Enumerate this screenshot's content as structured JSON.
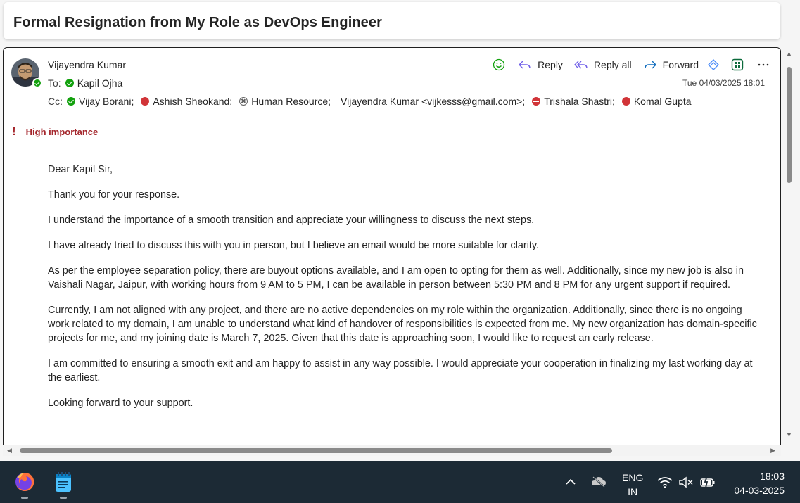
{
  "subject": "Formal Resignation from My Role as DevOps Engineer",
  "message": {
    "sender": "Vijayendra Kumar",
    "to_label": "To:",
    "to": [
      {
        "name": "Kapil Ojha",
        "status": "available"
      }
    ],
    "cc_label": "Cc:",
    "cc": [
      {
        "name": "Vijay Borani;",
        "status": "available"
      },
      {
        "name": "Ashish Sheokand;",
        "status": "busy"
      },
      {
        "name": "Human Resource;",
        "status": "offline"
      },
      {
        "name": "Vijayendra Kumar <vijkesss@gmail.com>;",
        "status": "none"
      },
      {
        "name": "Trishala Shastri;",
        "status": "do-not-disturb"
      },
      {
        "name": "Komal Gupta",
        "status": "busy"
      }
    ],
    "timestamp": "Tue 04/03/2025 18:01",
    "importance": "High importance",
    "actions": {
      "reply": "Reply",
      "reply_all": "Reply all",
      "forward": "Forward"
    },
    "body": [
      "Dear Kapil Sir,",
      "Thank you for your response.",
      "I understand the importance of a smooth transition and appreciate your willingness to discuss the next steps.",
      "I have already tried to discuss this with you in person, but I believe an email would be more suitable for clarity.",
      "As per the employee separation policy, there are buyout options available, and I am open to opting for them as well. Additionally, since my new job is also in Vaishali Nagar, Jaipur, with working hours from 9 AM to 5 PM, I can be available in person between 5:30 PM and 8 PM for any urgent support if required.",
      "Currently, I am not aligned with any project, and there are no active dependencies on my role within the organization. Additionally, since there is no ongoing work related to my domain, I am unable to understand what kind of handover of responsibilities is expected from me. My new organization has domain-specific projects for me, and my joining date is March 7, 2025. Given that this date is approaching soon, I would like to request an early release.",
      "I am committed to ensuring a smooth exit and am happy to assist in any way possible. I would appreciate your cooperation in finalizing my last working day at the earliest.",
      "Looking forward to your support."
    ]
  },
  "colors": {
    "accent": "#0f6cbd",
    "importance": "#a4262c",
    "available": "#13a10e",
    "busy": "#d13438",
    "taskbar": "#1c2a35"
  },
  "taskbar": {
    "apps": [
      "firefox-icon",
      "notepad-icon"
    ],
    "language": {
      "line1": "ENG",
      "line2": "IN"
    },
    "time": "18:03",
    "date": "04-03-2025"
  }
}
